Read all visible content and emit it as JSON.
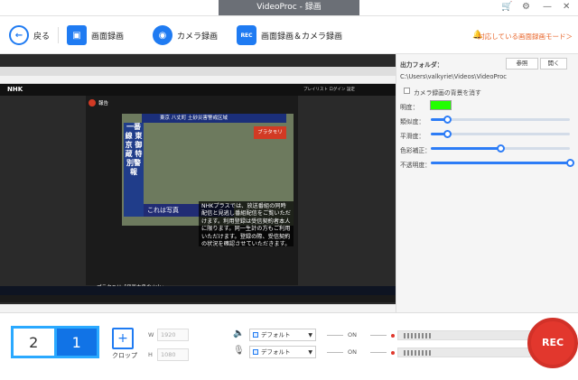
{
  "window": {
    "title": "VideoProc - 録画"
  },
  "toolbar": {
    "back_label": "戻る",
    "screen_rec_label": "画面録画",
    "camera_rec_label": "カメラ録画",
    "screen_camera_label": "画面録画＆カメラ録画",
    "mode_link": "対応している画面録画モード＞",
    "rec_badge": "REC"
  },
  "preview": {
    "site_logo": "NHK",
    "header_meta": "プレイリスト  ログイン  設定",
    "badge": "報告",
    "banner": "東京 八丈町 土砂災害警戒区域",
    "vertical_caption": "一番線 東京 御蔵 特別警報",
    "caption": "これは写真",
    "program_logo": "ブラタモリ",
    "overlay_text": "NHKプラスでは、放送番組の同時配信と見逃し番組配信をご覧いただけます。利用登録は受信契約者本人に限ります。同一生計の方もご利用いただけます。登録の際、受信契約の状況を確認させていただきます。",
    "program_title": "ブラタモリ「伊豆大島の火山」"
  },
  "panel": {
    "output_folder_label": "出力フォルダ：",
    "browse_label": "参照",
    "open_label": "開く",
    "folder_path": "C:\\Users\\valkyrie\\Videos\\VideoProc",
    "camera_bg_label": "カメラ録画の背景を消す",
    "chroma_label": "明度：",
    "chroma_color": "#22ff00",
    "sliders": [
      {
        "label": "類似度：",
        "value": 0.12
      },
      {
        "label": "平滑度：",
        "value": 0.12
      },
      {
        "label": "色彩補正：",
        "value": 0.5
      },
      {
        "label": "不透明度：",
        "value": 1.0
      }
    ]
  },
  "bottom": {
    "screen1": "2",
    "screen2": "1",
    "crop_label": "クロップ",
    "width_label": "W",
    "width_value": "1920",
    "height_label": "H",
    "height_value": "1080",
    "speaker_select": "デフォルト",
    "mic_select": "デフォルト",
    "speaker_state": "ON",
    "mic_state": "ON",
    "rec_label": "REC"
  }
}
